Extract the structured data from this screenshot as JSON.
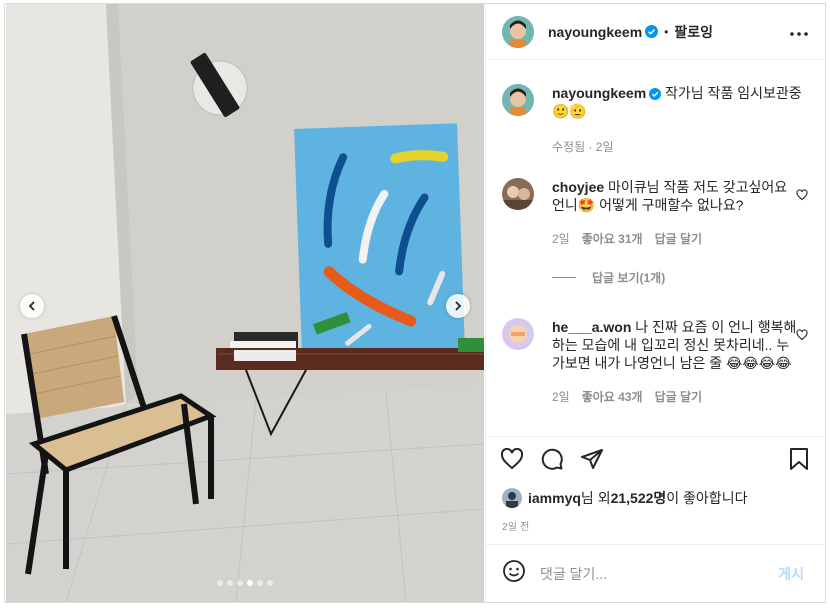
{
  "header": {
    "username": "nayoungkeem",
    "dot": "•",
    "follow_label": "팔로잉"
  },
  "caption": {
    "username": "nayoungkeem",
    "text": "작가님 작품 임시보관중",
    "emoji": "🙂🫡",
    "edited_label": "수정됨 · 2일"
  },
  "comments": [
    {
      "username": "choyjee",
      "text": "마이큐님 작품 저도 갖고싶어요 언니🤩 어떻게 구매할수 없나요?",
      "time": "2일",
      "likes": "좋아요 31개",
      "reply": "답글 달기",
      "view_replies": "답글 보기(1개)"
    },
    {
      "username": "he___a.won",
      "text": "나 진짜 요즘 이 언니 행복해하는 모습에 내 입꼬리 정신 못차리네.. 누가보면 내가 나영언니 남은 줄 😂😂😂😂",
      "time": "2일",
      "likes": "좋아요 43개",
      "reply": "답글 달기"
    }
  ],
  "likes": {
    "user": "iammyq",
    "middle": "님 외 ",
    "count": "21,522명",
    "suffix": "이 좋아합니다"
  },
  "timestamp": "2일 전",
  "composer": {
    "placeholder": "댓글 달기...",
    "post_label": "게시"
  },
  "carousel": {
    "total": 6,
    "active_index": 3
  },
  "colors": {
    "verified": "#0095f6",
    "artwork_bg": "#5fb3e0",
    "post_disabled": "#b3dbff"
  }
}
